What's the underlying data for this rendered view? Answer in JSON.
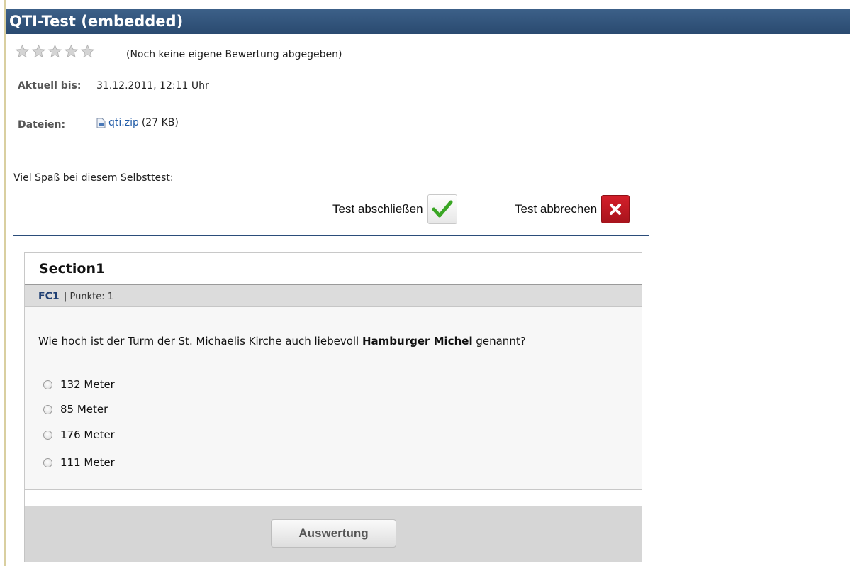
{
  "page": {
    "title": "QTI-Test (embedded)"
  },
  "rating": {
    "stars_total": 5,
    "stars_filled": 0,
    "text": "(Noch keine eigene Bewertung abgegeben)"
  },
  "meta": {
    "current_label": "Aktuell bis:",
    "current_value": "31.12.2011, 12:11 Uhr",
    "files_label": "Dateien:",
    "file_name": "qti.zip",
    "file_size": "(27 KB)"
  },
  "intro": "Viel Spaß bei diesem Selbsttest:",
  "actions": {
    "finish_label": "Test abschließen",
    "cancel_label": "Test abbrechen"
  },
  "section": {
    "title": "Section1",
    "question_id": "FC1",
    "points": "| Punkte: 1",
    "question_prefix": "Wie hoch ist der Turm der St. Michaelis Kirche auch liebevoll ",
    "question_bold": "Hamburger Michel",
    "question_suffix": " genannt?",
    "choices": [
      "132 Meter",
      "85 Meter",
      "176 Meter",
      "111 Meter"
    ]
  },
  "footer": {
    "evaluate_label": "Auswertung"
  },
  "colors": {
    "title_bar": "#2f5279",
    "link": "#1f5aa6",
    "accent_divider": "#2b4d7a"
  }
}
